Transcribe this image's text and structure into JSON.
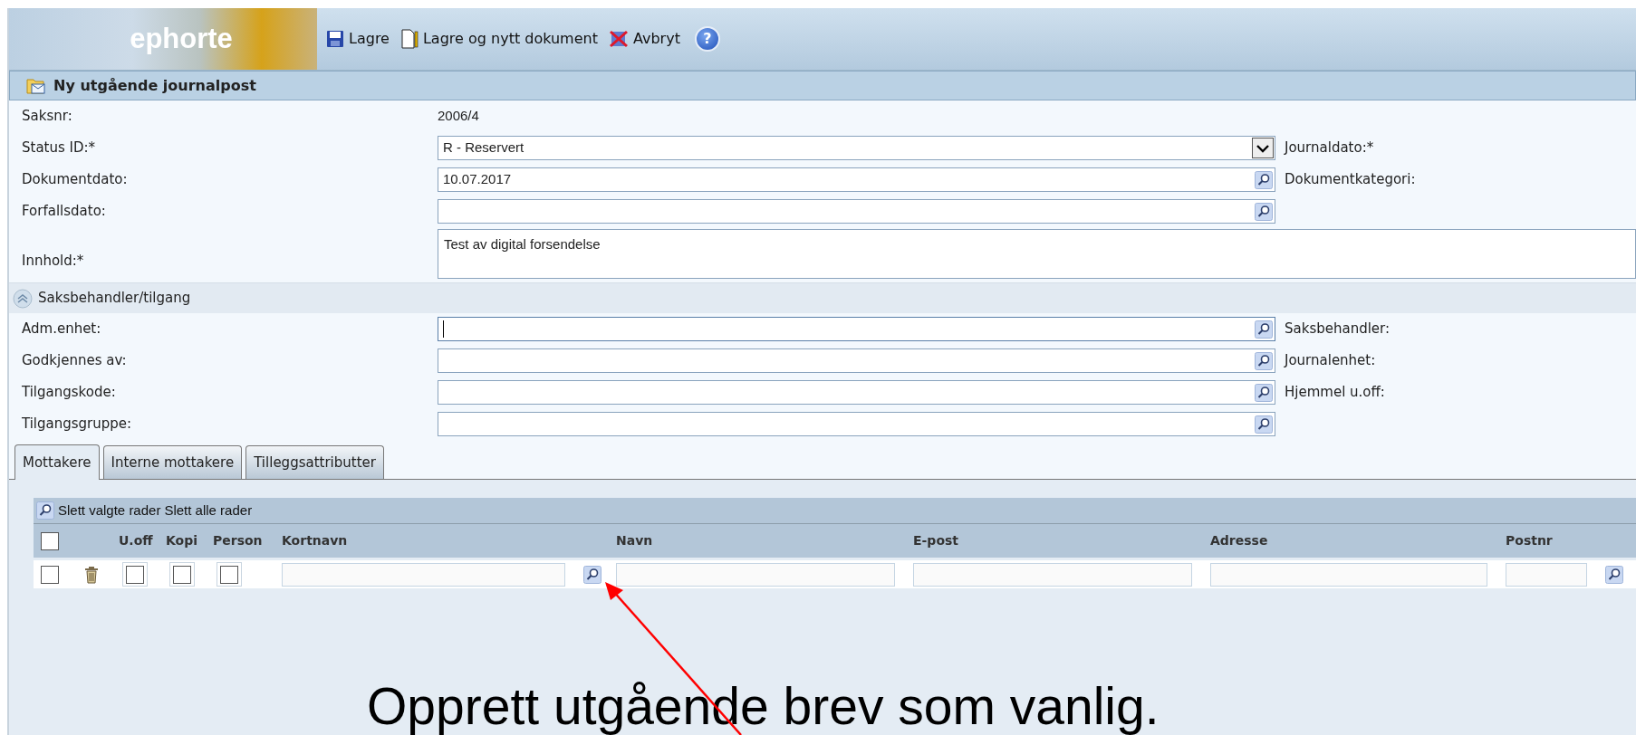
{
  "toolbar": {
    "logo": "ephorte",
    "help_label": "?",
    "buttons": [
      {
        "label": "Lagre",
        "kind": "save"
      },
      {
        "label": "Lagre og nytt dokument",
        "kind": "new"
      },
      {
        "label": "Avbryt",
        "kind": "cancel"
      }
    ]
  },
  "panel": {
    "title": "Ny utgående journalpost"
  },
  "fields": [
    {
      "label": "Saksnr:",
      "kind": "text",
      "value": "2006/4"
    },
    {
      "label": "Status ID:*",
      "kind": "select",
      "value": "R - Reservert",
      "side_label": "Journaldato:*"
    },
    {
      "label": "Dokumentdato:",
      "kind": "lookup",
      "value": "10.07.2017",
      "side_label": "Dokumentkategori:"
    },
    {
      "label": "Forfallsdato:",
      "kind": "lookup"
    },
    {
      "label": "Innhold:*",
      "kind": "textarea",
      "value": "Test av digital forsendelse"
    }
  ],
  "section": {
    "title": "Saksbehandler/tilgang",
    "expanded": true,
    "fields": [
      {
        "label": "Adm.enhet:",
        "focused": true,
        "side_label": "Saksbehandler:"
      },
      {
        "label": "Godkjennes av:",
        "focused": false,
        "side_label": "Journalenhet:"
      },
      {
        "label": "Tilgangskode:",
        "focused": false,
        "side_label": "Hjemmel u.off:"
      },
      {
        "label": "Tilgangsgruppe:",
        "focused": false
      }
    ]
  },
  "tabs": [
    {
      "label": "Mottakere",
      "selected": true
    },
    {
      "label": "Interne mottakere",
      "selected": false
    },
    {
      "label": "Tilleggsattributter",
      "selected": false
    }
  ],
  "recipients": {
    "actions": [
      "Slett valgte rader",
      "Slett alle rader"
    ],
    "all_selected": false,
    "columns": [
      "U.off",
      "Kopi",
      "Person",
      "Kortnavn",
      "Navn",
      "E-post",
      "Adresse",
      "Postnr"
    ],
    "rows": [
      {
        "selected": false,
        "u_off": false,
        "kopi": false,
        "person": false
      }
    ]
  },
  "caption": "Opprett utgående brev som vanlig."
}
